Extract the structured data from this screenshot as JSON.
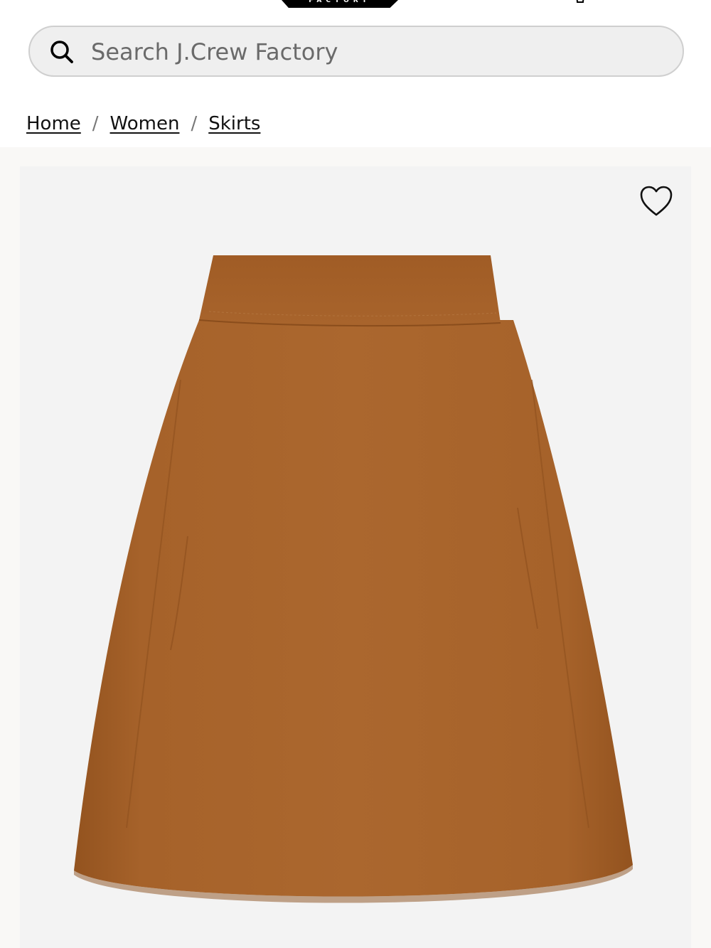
{
  "header": {
    "logo_text": "FACTORY",
    "bag_icon": "shopping-bag-icon"
  },
  "search": {
    "placeholder": "Search J.Crew Factory",
    "value": "",
    "icon": "search-icon"
  },
  "breadcrumb": {
    "items": [
      {
        "label": "Home"
      },
      {
        "label": "Women"
      },
      {
        "label": "Skirts"
      }
    ],
    "separator": "/"
  },
  "product": {
    "wishlist_icon": "heart-icon",
    "image_alt": "suede A-line mini skirt",
    "colors": {
      "skirt": "#a6622a",
      "skirt_shadow": "#93531f",
      "background": "#f3f3f3"
    }
  }
}
